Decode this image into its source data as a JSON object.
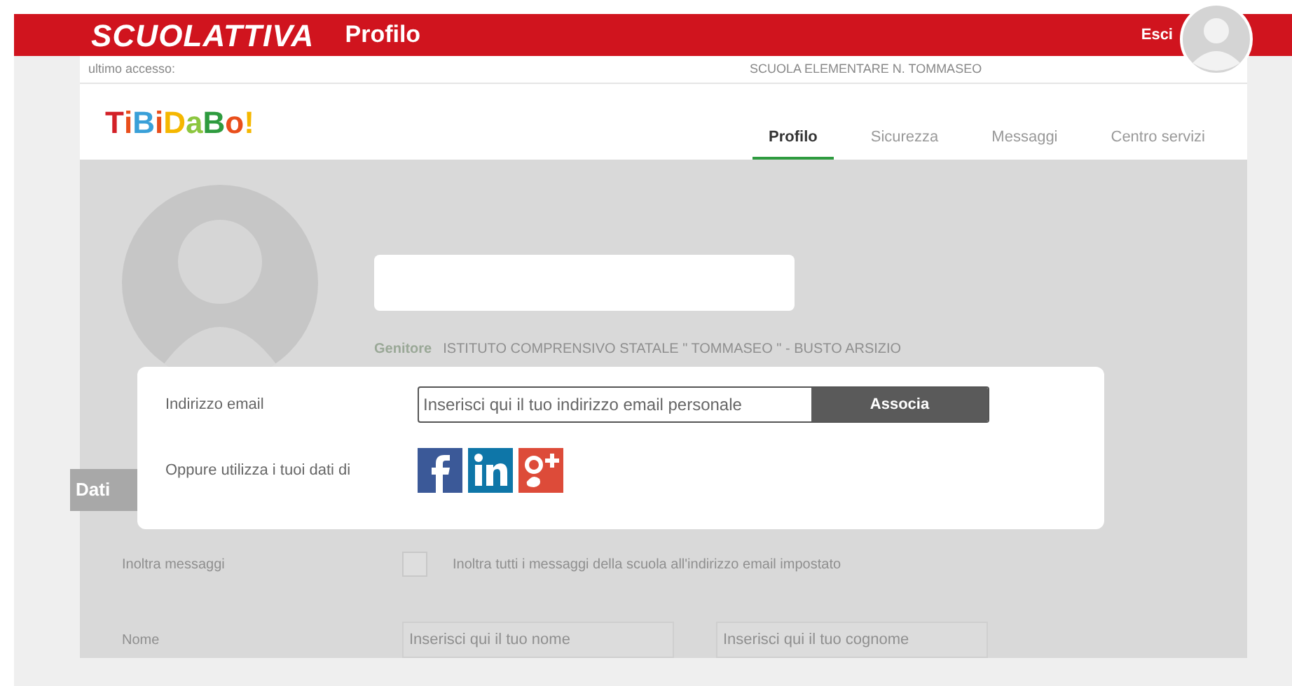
{
  "header": {
    "brand": "SCUOLATTIVA",
    "title": "Profilo",
    "logout": "Esci"
  },
  "info_bar": {
    "last_access": "ultimo accesso:",
    "school": "SCUOLA ELEMENTARE N. TOMMASEO"
  },
  "logo": {
    "letters": [
      {
        "text": "T",
        "color": "#d32027"
      },
      {
        "text": "i",
        "color": "#e94e1b"
      },
      {
        "text": "B",
        "color": "#3aa0d8"
      },
      {
        "text": "i",
        "color": "#e94e1b"
      },
      {
        "text": "D",
        "color": "#f5b700"
      },
      {
        "text": "a",
        "color": "#8cc63f"
      },
      {
        "text": "B",
        "color": "#2e9b3f"
      },
      {
        "text": "o",
        "color": "#e94e1b"
      },
      {
        "text": "!",
        "color": "#f5b700"
      }
    ]
  },
  "tabs": [
    {
      "label": "Profilo",
      "selected": true
    },
    {
      "label": "Sicurezza",
      "selected": false
    },
    {
      "label": "Messaggi",
      "selected": false
    },
    {
      "label": "Centro servizi",
      "selected": false
    }
  ],
  "profile": {
    "role": "Genitore",
    "institute": "ISTITUTO COMPRENSIVO STATALE \" TOMMASEO \" - BUSTO ARSIZIO"
  },
  "section_tab": "Dati",
  "form": {
    "forward_label": "Inoltra messaggi",
    "forward_checked": false,
    "forward_text": "Inoltra tutti i messaggi della scuola all'indirizzo email impostato",
    "name_label": "Nome",
    "name_placeholder": "Inserisci qui il tuo nome",
    "surname_placeholder": "Inserisci qui il tuo cognome"
  },
  "dialog": {
    "email_label": "Indirizzo email",
    "email_placeholder": "Inserisci qui il tuo indirizzo email personale",
    "associate_button": "Associa",
    "social_label": "Oppure utilizza i tuoi dati di",
    "social": [
      {
        "kind": "facebook"
      },
      {
        "kind": "linkedin"
      },
      {
        "kind": "googleplus"
      }
    ]
  }
}
